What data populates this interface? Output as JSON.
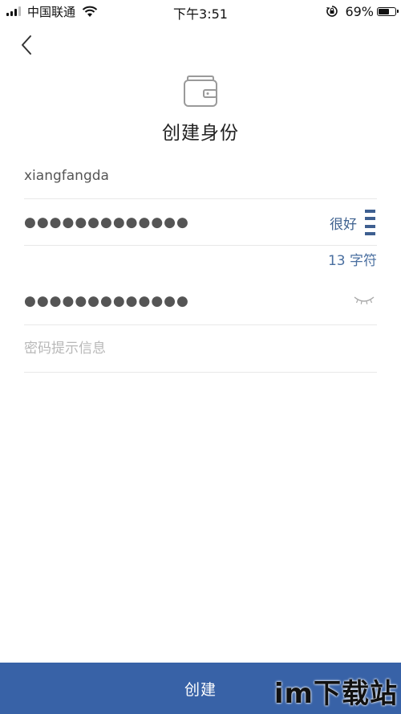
{
  "status_bar": {
    "carrier": "中国联通",
    "time": "下午3:51",
    "battery": "69%",
    "signal_icon": "signal-bars-icon",
    "wifi_icon": "wifi-icon",
    "rotation_lock_icon": "rotation-lock-icon",
    "battery_icon": "battery-icon",
    "battery_level": 0.69
  },
  "nav": {
    "back_icon": "chevron-left-icon"
  },
  "header": {
    "icon": "wallet-icon",
    "title": "创建身份"
  },
  "form": {
    "identity_name": "xiangfangda",
    "password_masked": "●●●●●●●●●●●●●",
    "strength_label": "很好",
    "strength_icon": "strength-bars-icon",
    "char_count": "13 字符",
    "repeat_password_masked": "●●●●●●●●●●●●●",
    "eye_icon": "eye-closed-icon",
    "hint_placeholder": "密码提示信息",
    "hint_value": ""
  },
  "actions": {
    "create_label": "创建"
  },
  "watermark": {
    "text": "im下载站"
  },
  "colors": {
    "accent": "#3862a7",
    "strength": "#3e5f90",
    "divider": "#e8e8e8",
    "placeholder": "#b8b8b8"
  }
}
